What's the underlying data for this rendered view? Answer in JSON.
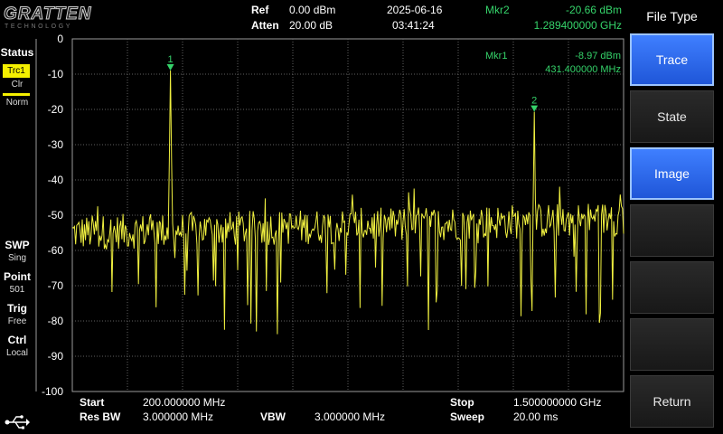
{
  "brand": {
    "name": "GRATTEN",
    "subtitle": "TECHNOLOGY"
  },
  "header": {
    "ref_label": "Ref",
    "ref_value": "0.00 dBm",
    "atten_label": "Atten",
    "atten_value": "20.00 dB",
    "date": "2025-06-16",
    "time": "03:41:24",
    "mkr2_label": "Mkr2",
    "mkr2_level": "-20.66 dBm",
    "mkr2_freq": "1.289400000 GHz"
  },
  "status": {
    "title": "Status",
    "trace": "Trc1",
    "mode": "Clr",
    "detector": "Norm",
    "swp_label": "SWP",
    "swp_value": "Sing",
    "point_label": "Point",
    "point_value": "501",
    "trig_label": "Trig",
    "trig_value": "Free",
    "ctrl_label": "Ctrl",
    "ctrl_value": "Local"
  },
  "plot": {
    "y_ticks": [
      "0",
      "-10",
      "-20",
      "-30",
      "-40",
      "-50",
      "-60",
      "-70",
      "-80",
      "-90",
      "-100"
    ],
    "mkr1_label": "Mkr1",
    "mkr1_level": "-8.97 dBm",
    "mkr1_freq": "431.400000 MHz",
    "marker1_tag": "1",
    "marker2_tag": "2",
    "colors": {
      "trace": "#f0f040",
      "marker": "#35d36a",
      "grid": "#606060"
    }
  },
  "chart_data": {
    "type": "line",
    "x_unit": "MHz",
    "y_unit": "dBm",
    "xlim": [
      200,
      1500
    ],
    "ylim": [
      -100,
      0
    ],
    "points": 501,
    "noise_floor_dbm": -55,
    "grid": true,
    "markers": [
      {
        "name": "Mkr1",
        "x": 431.4,
        "y": -8.97
      },
      {
        "name": "Mkr2",
        "x": 1289.4,
        "y": -20.66
      }
    ]
  },
  "footer": {
    "start_label": "Start",
    "start_value": "200.000000 MHz",
    "rbw_label": "Res BW",
    "rbw_value": "3.000000 MHz",
    "vbw_label": "VBW",
    "vbw_value": "3.000000 MHz",
    "stop_label": "Stop",
    "stop_value": "1.500000000 GHz",
    "sweep_label": "Sweep",
    "sweep_value": "20.00 ms"
  },
  "menu": {
    "title": "File Type",
    "keys": [
      "Trace",
      "State",
      "Image",
      "",
      "",
      "",
      "Return"
    ],
    "active": [
      true,
      false,
      true,
      false,
      false,
      false,
      false
    ]
  },
  "icons": {
    "usb": "usb-icon"
  }
}
